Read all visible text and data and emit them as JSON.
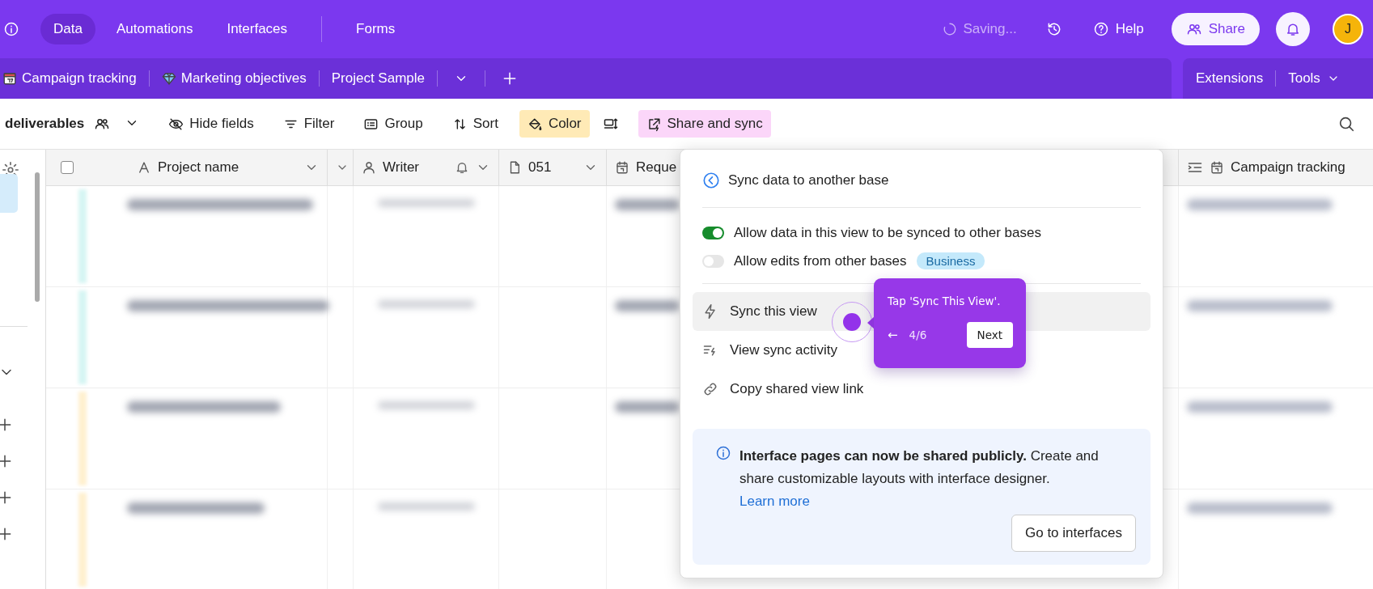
{
  "nav": {
    "tabs": [
      {
        "label": "Data",
        "selected": true
      },
      {
        "label": "Automations",
        "selected": false
      },
      {
        "label": "Interfaces",
        "selected": false
      },
      {
        "label": "Forms",
        "selected": false
      }
    ],
    "status": "Saving...",
    "help": "Help",
    "share": "Share",
    "avatar": "J"
  },
  "tables": {
    "tabs": [
      {
        "label": "Campaign tracking"
      },
      {
        "label": "Marketing objectives"
      },
      {
        "label": "Project Sample"
      }
    ],
    "right": [
      "Extensions",
      "Tools"
    ]
  },
  "toolbar": {
    "view": "deliverables",
    "items": [
      {
        "label": "Hide fields"
      },
      {
        "label": "Filter"
      },
      {
        "label": "Group"
      },
      {
        "label": "Sort"
      },
      {
        "label": "Color",
        "color": "#ffeab6"
      },
      {
        "label": "Share and sync",
        "color": "#fbd6f9"
      }
    ]
  },
  "grid": {
    "select_all": {
      "checked": false
    },
    "columns": [
      {
        "label": "Project name"
      },
      {
        "label": "Writer"
      },
      {
        "label": "051"
      },
      {
        "label": "Reque"
      },
      {
        "label": "Campaign tracking"
      }
    ],
    "rows": [
      {
        "color": "#d6f5f3"
      },
      {
        "color": "#d6f5f3"
      },
      {
        "color": "#fff0cf"
      },
      {
        "color": "#fff0cf"
      }
    ]
  },
  "popup": {
    "back": "Sync data to another base",
    "toggles": [
      {
        "label": "Allow data in this view to be synced to other bases",
        "on": true
      },
      {
        "label": "Allow edits from other bases",
        "on": false,
        "badge": "Business"
      }
    ],
    "actions": [
      {
        "label": "Sync this view",
        "selected": true
      },
      {
        "label": "View sync activity",
        "selected": false
      },
      {
        "label": "Copy shared view link",
        "selected": false
      }
    ],
    "info": {
      "text": "**Interface pages can now be shared publicly.** Create and share customizable layouts with interface designer.",
      "link": "Learn more",
      "button": "Go to interfaces"
    }
  },
  "tour": {
    "text": "Tap 'Sync This View'.",
    "back": "←",
    "step": "4/6",
    "next": "Next"
  }
}
